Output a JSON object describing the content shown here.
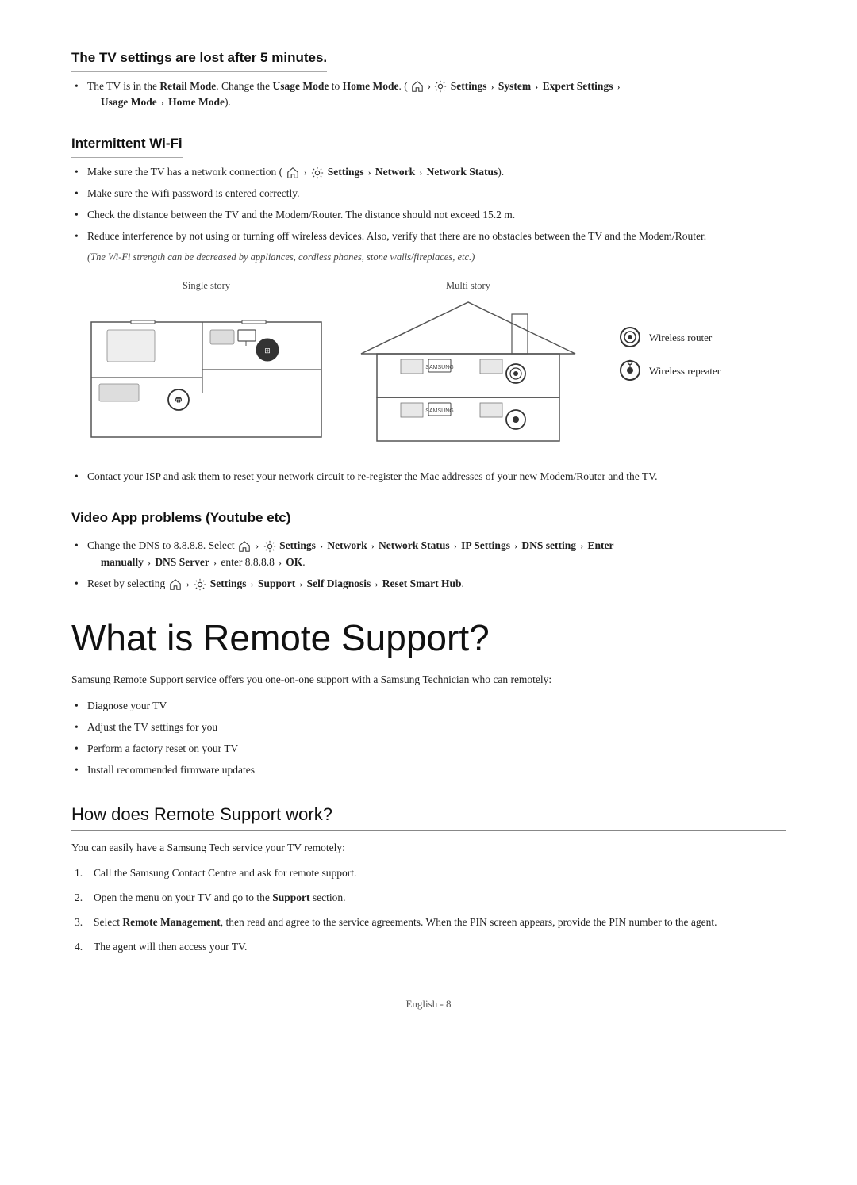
{
  "sections": {
    "tv_settings": {
      "title": "The TV settings are lost after 5 minutes.",
      "bullets": [
        {
          "text": "The TV is in the ",
          "bold_parts": [
            "Retail Mode"
          ],
          "rest": ". Change the ",
          "bold_parts2": [
            "Usage Mode"
          ],
          "rest2": " to ",
          "bold_parts3": [
            "Home Mode"
          ],
          "rest3": ". (",
          "nav": "Settings > System > Expert Settings > Usage Mode > Home Mode",
          "suffix": ")."
        }
      ]
    },
    "intermittent_wifi": {
      "title": "Intermittent Wi-Fi",
      "bullets": [
        "Make sure the TV has a network connection ( [home] > [gear] Settings > Network > Network Status).",
        "Make sure the Wifi password is entered correctly.",
        "Check the distance between the TV and the Modem/Router. The distance should not exceed 15.2 m.",
        "Reduce interference by not using or turning off wireless devices. Also, verify that there are no obstacles between the TV and the Modem/Router."
      ],
      "note": "(The Wi-Fi strength can be decreased by appliances, cordless phones, stone walls/fireplaces, etc.)",
      "diagram": {
        "single_label": "Single story",
        "multi_label": "Multi story",
        "legend": [
          {
            "icon": "router",
            "label": "Wireless router"
          },
          {
            "icon": "repeater",
            "label": "Wireless repeater"
          }
        ]
      },
      "after_bullet": "Contact your ISP and ask them to reset your network circuit to re-register the Mac addresses of your new Modem/Router and the TV."
    },
    "video_app": {
      "title": "Video App problems (Youtube etc)",
      "bullets": [
        {
          "main": "Change the DNS to 8.8.8.8. Select [home] > [gear] Settings > Network > Network Status > IP Settings > DNS setting > Enter manually > DNS Server > enter 8.8.8.8 > OK."
        },
        {
          "main": "Reset by selecting [home] > [gear] Settings > Support > Self Diagnosis > Reset Smart Hub."
        }
      ]
    },
    "remote_support": {
      "big_title": "What is Remote Support?",
      "intro": "Samsung Remote Support service offers you one-on-one support with a Samsung Technician who can remotely:",
      "bullets": [
        "Diagnose your TV",
        "Adjust the TV settings for you",
        "Perform a factory reset on your TV",
        "Install recommended firmware updates"
      ]
    },
    "how_remote": {
      "title": "How does Remote Support work?",
      "intro": "You can easily have a Samsung Tech service your TV remotely:",
      "steps": [
        "Call the Samsung Contact Centre and ask for remote support.",
        "Open the menu on your TV and go to the Support section.",
        "Select Remote Management, then read and agree to the service agreements. When the PIN screen appears, provide the PIN number to the agent.",
        "The agent will then access your TV."
      ]
    }
  },
  "footer": {
    "text": "English - 8"
  },
  "icons": {
    "home": "⌂",
    "gear": "⚙",
    "bullet": "•",
    "chevron": "›"
  }
}
